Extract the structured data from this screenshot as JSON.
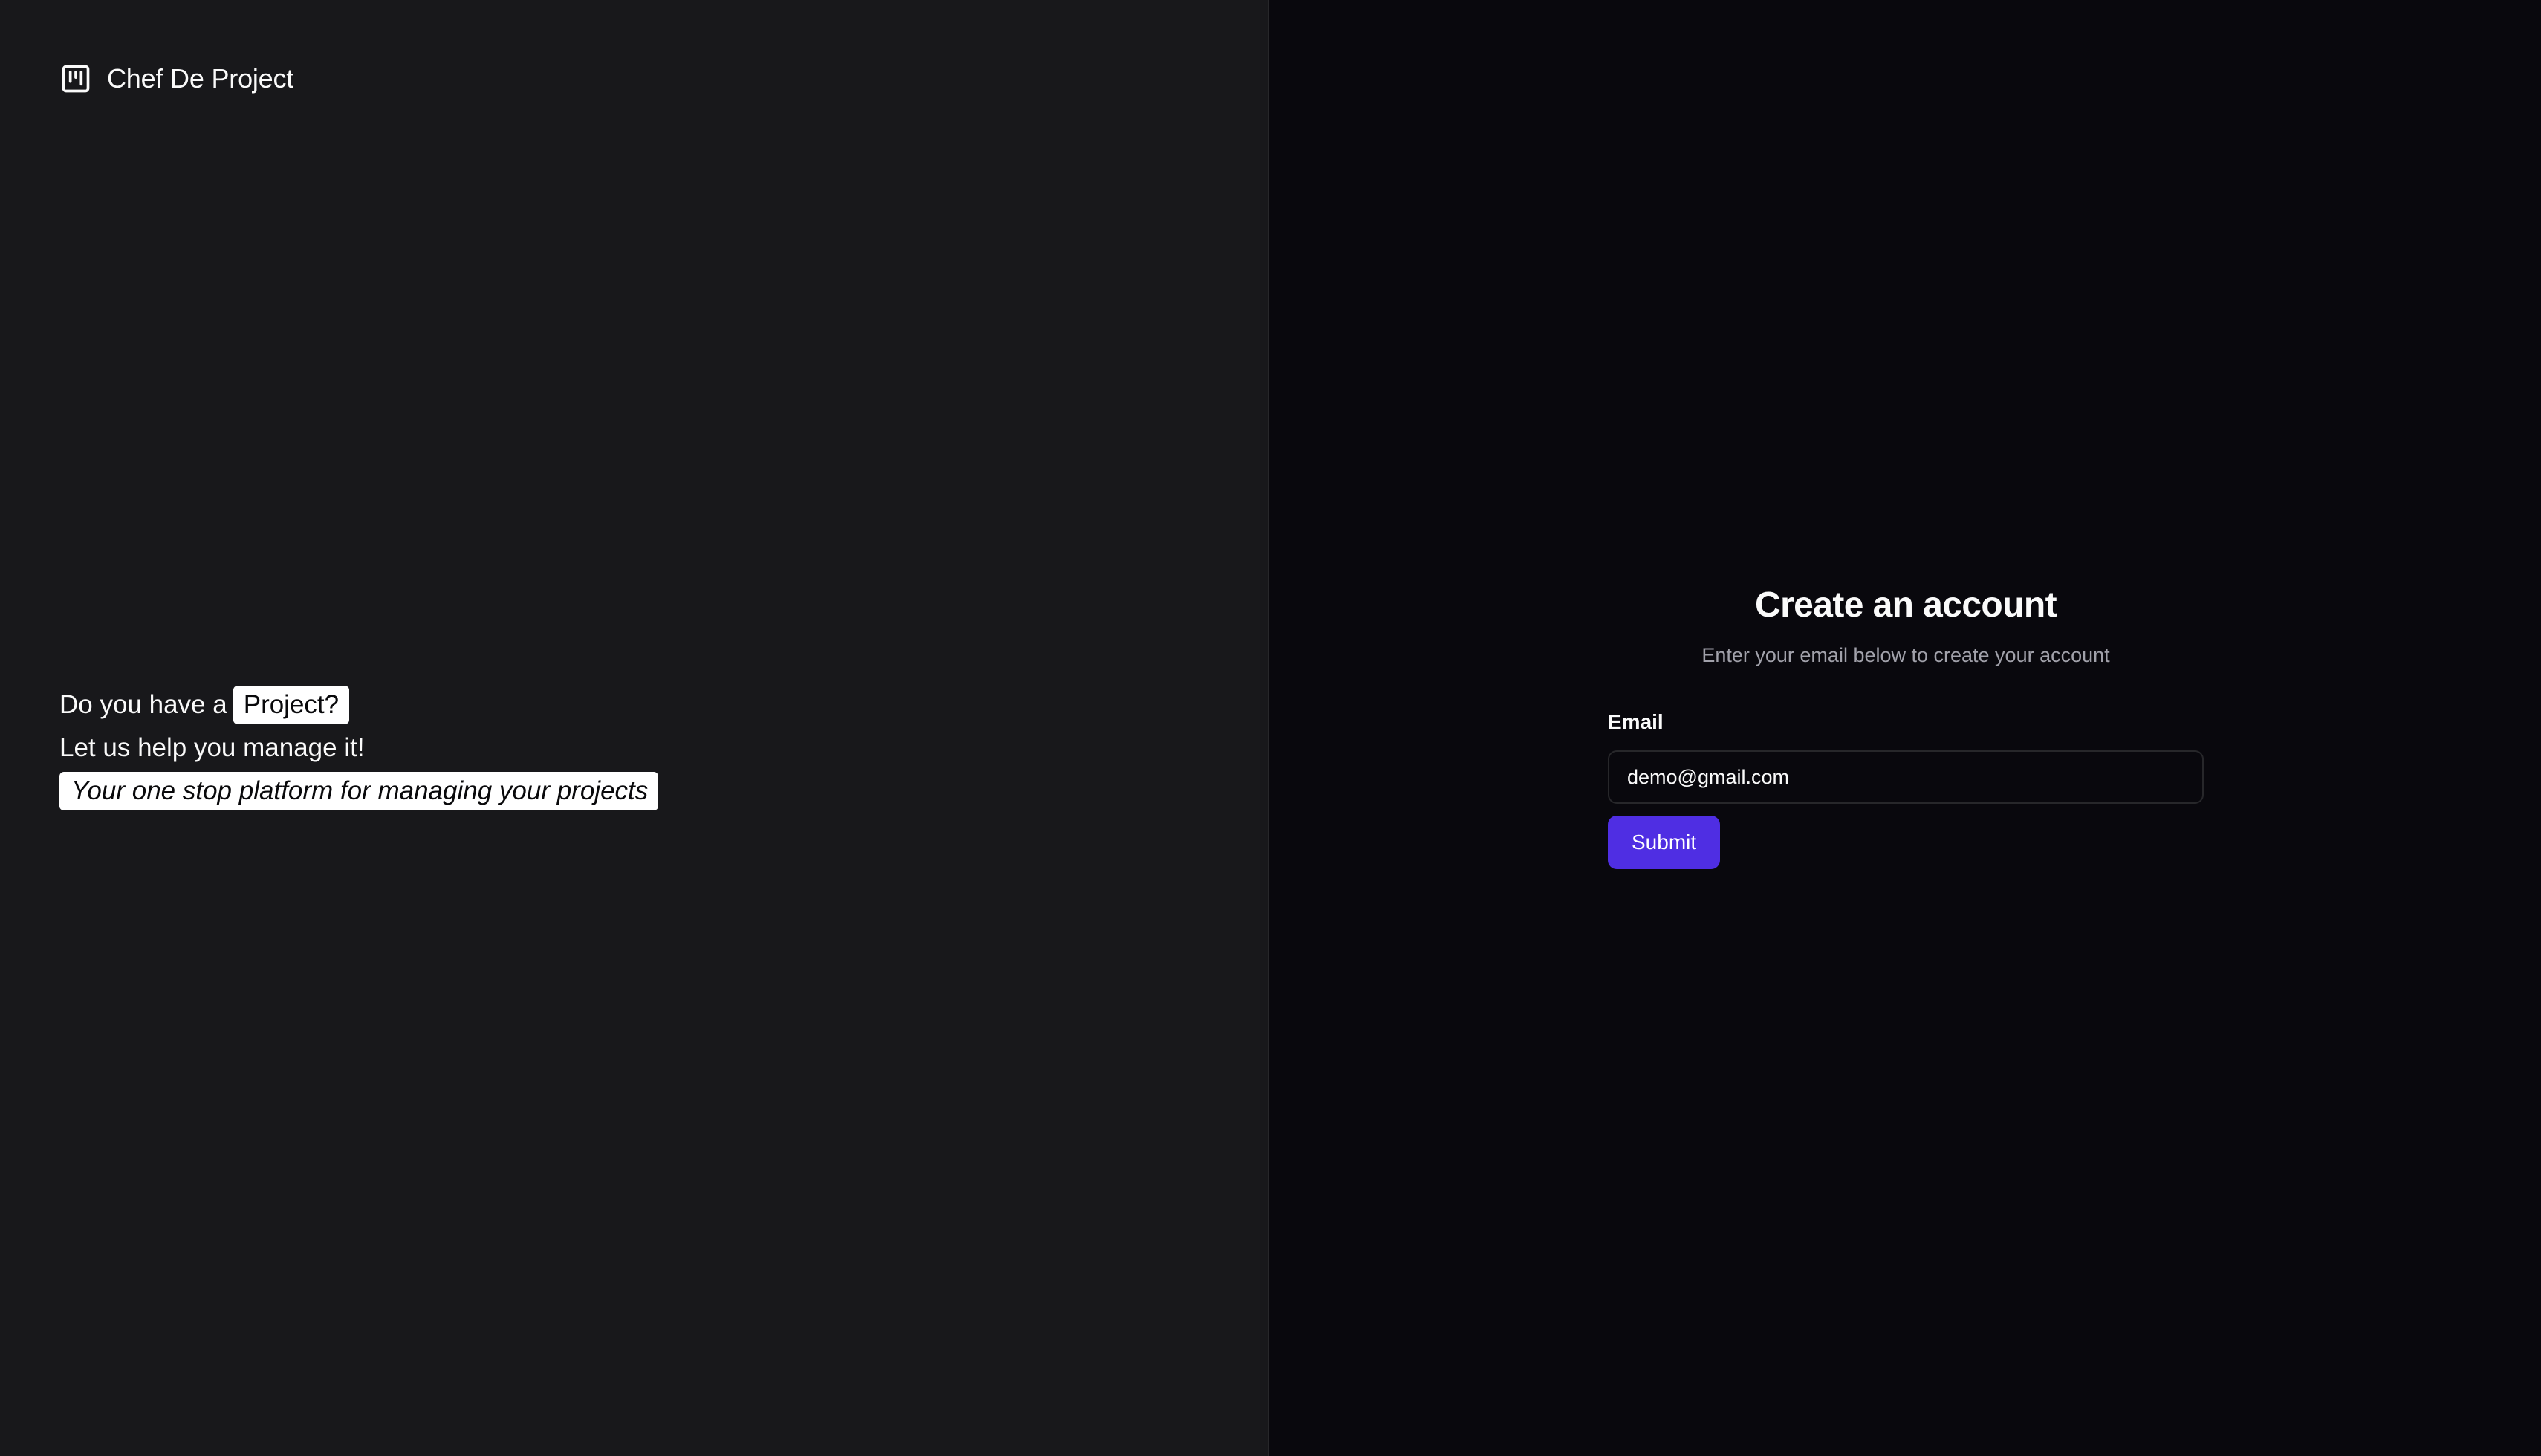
{
  "brand": {
    "name": "Chef De Project",
    "icon": "kanban-icon"
  },
  "hero": {
    "line1_prefix": "Do you have a",
    "line1_highlight": "Project?",
    "line2": "Let us help you manage it!",
    "line3_highlight": "Your one stop platform for managing your projects"
  },
  "form": {
    "title": "Create an account",
    "subtitle": "Enter your email below to create your account",
    "email_label": "Email",
    "email_value": "demo@gmail.com",
    "submit_label": "Submit"
  },
  "colors": {
    "left_bg": "#18181b",
    "right_bg": "#09080d",
    "accent": "#4f2ee3",
    "text": "#fafafa",
    "muted": "#a1a1aa",
    "border": "#27272a"
  }
}
